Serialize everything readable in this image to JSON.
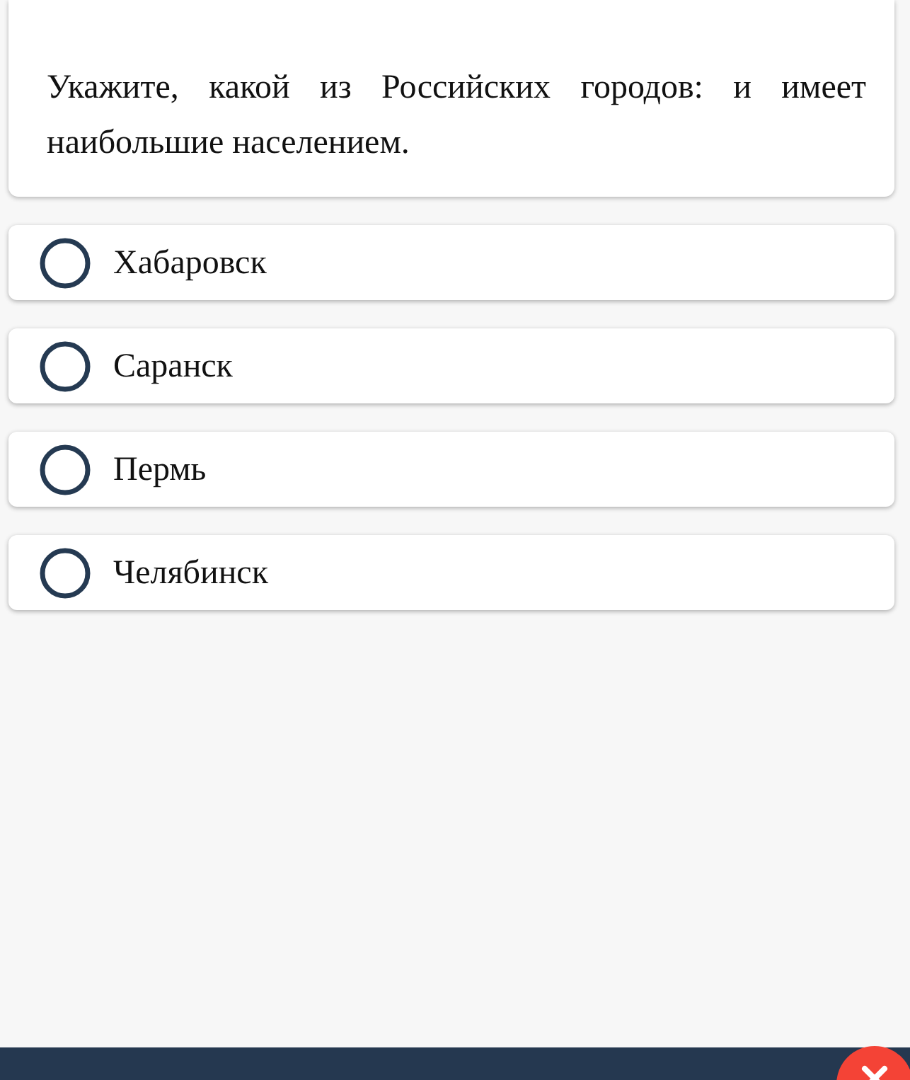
{
  "question": {
    "text": "Укажите, какой из Российских городов: и имеет наибольшие населением."
  },
  "options": [
    {
      "label": "Хабаровск",
      "selected": false
    },
    {
      "label": "Саранск",
      "selected": false
    },
    {
      "label": "Пермь",
      "selected": false
    },
    {
      "label": "Челябинск",
      "selected": false
    }
  ]
}
